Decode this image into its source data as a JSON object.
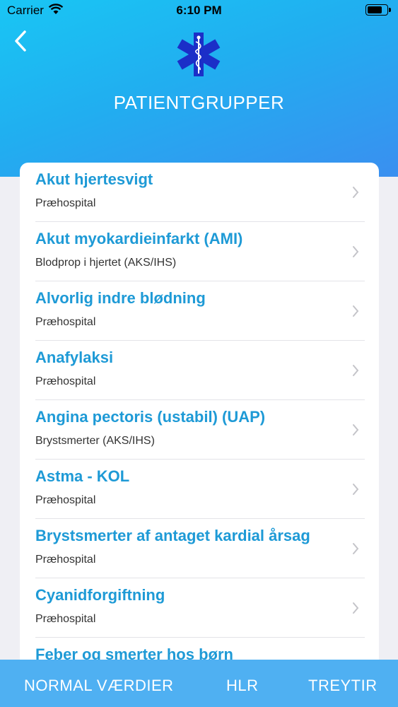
{
  "status_bar": {
    "carrier": "Carrier",
    "time": "6:10 PM"
  },
  "header": {
    "title": "PATIENTGRUPPER",
    "logo_icon": "star-of-life-icon",
    "back_icon": "chevron-left-icon"
  },
  "colors": {
    "accent": "#1e9ad6",
    "header_gradient_start": "#19c6f4",
    "header_gradient_end": "#3a8ff0",
    "tabbar": "#4fb0f2"
  },
  "list": {
    "items": [
      {
        "title": "Akut hjertesvigt",
        "subtitle": "Præhospital"
      },
      {
        "title": "Akut myokardieinfarkt (AMI)",
        "subtitle": "Blodprop i hjertet (AKS/IHS)"
      },
      {
        "title": "Alvorlig indre blødning",
        "subtitle": "Præhospital"
      },
      {
        "title": "Anafylaksi",
        "subtitle": "Præhospital"
      },
      {
        "title": "Angina pectoris (ustabil) (UAP)",
        "subtitle": "Brystsmerter (AKS/IHS)"
      },
      {
        "title": "Astma - KOL",
        "subtitle": "Præhospital"
      },
      {
        "title": "Brystsmerter af antaget kardial årsag",
        "subtitle": "Præhospital"
      },
      {
        "title": "Cyanidforgiftning",
        "subtitle": "Præhospital"
      },
      {
        "title": "Feber og smerter hos børn",
        "subtitle": ""
      }
    ]
  },
  "tabbar": {
    "tab1": "NORMAL VÆRDIER",
    "tab2": "HLR",
    "tab3": "TREYTIR"
  }
}
